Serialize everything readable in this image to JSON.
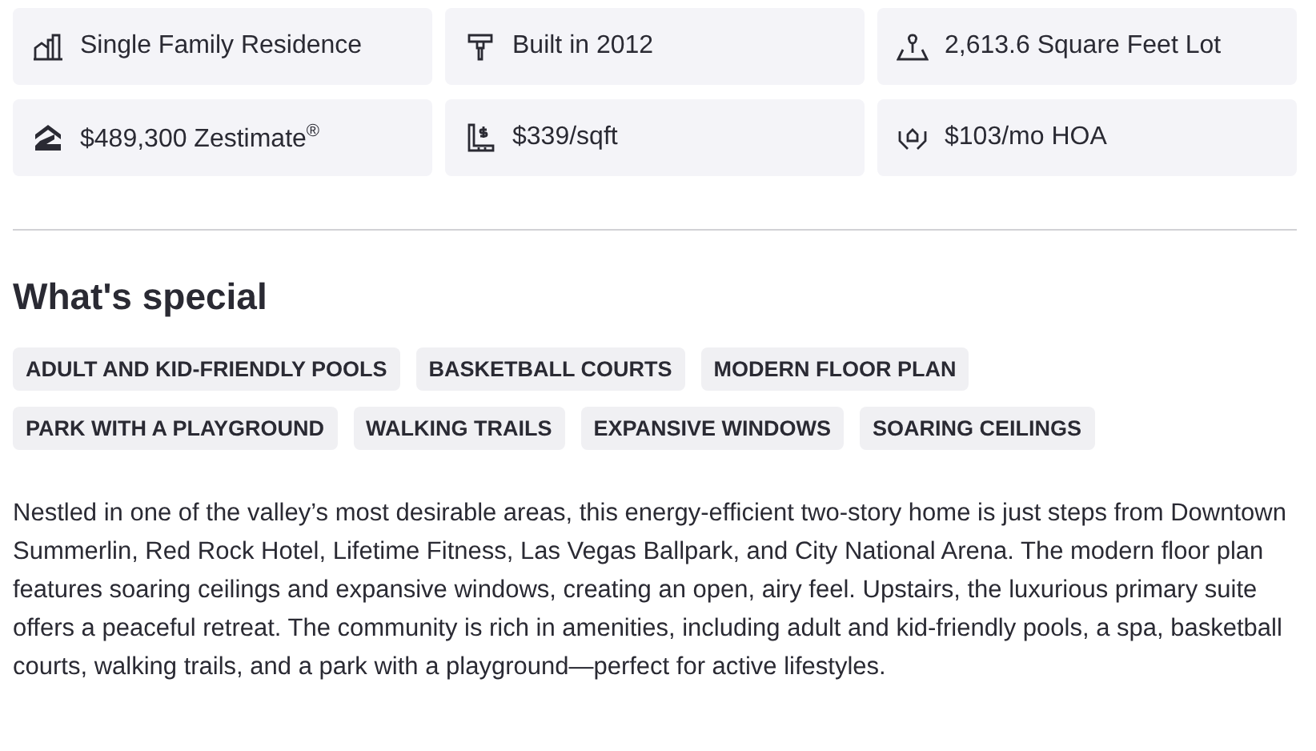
{
  "facts": [
    {
      "kind": "home-type",
      "text": "Single Family Residence"
    },
    {
      "kind": "year",
      "text": "Built in 2012"
    },
    {
      "kind": "lot",
      "text": "2,613.6 Square Feet Lot"
    },
    {
      "kind": "zestimate",
      "text": "$489,300 Zestimate$^{®}$"
    },
    {
      "kind": "price-per-sqft",
      "text": "$339/sqft"
    },
    {
      "kind": "hoa",
      "text": "$103/mo HOA"
    }
  ],
  "special": {
    "title": "What's special",
    "tags": [
      "ADULT AND KID-FRIENDLY POOLS",
      "BASKETBALL COURTS",
      "MODERN FLOOR PLAN",
      "PARK WITH A PLAYGROUND",
      "WALKING TRAILS",
      "EXPANSIVE WINDOWS",
      "SOARING CEILINGS"
    ],
    "description": "Nestled in one of the valley’s most desirable areas, this energy-efficient two-story home is just steps from Downtown Summerlin, Red Rock Hotel, Lifetime Fitness, Las Vegas Ballpark, and City National Arena. The modern floor plan features soaring ceilings and expansive windows, creating an open, airy feel. Upstairs, the luxurious primary suite offers a peaceful retreat. The community is rich in amenities, including adult and kid-friendly pools, a spa, basketball courts, walking trails, and a park with a playground—perfect for active lifestyles."
  }
}
